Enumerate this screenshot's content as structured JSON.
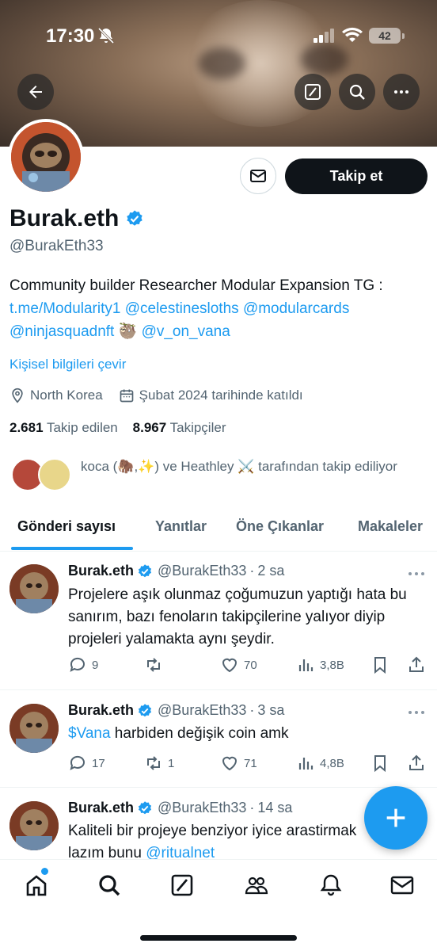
{
  "status": {
    "time": "17:30",
    "battery": "42"
  },
  "icons": {
    "back": "arrow-left-icon",
    "compose": "compose-icon",
    "search": "search-icon",
    "more": "more-icon"
  },
  "profile": {
    "name": "Burak.eth",
    "handle": "@BurakEth33",
    "follow_label": "Takip et",
    "bio_text": "Community builder Researcher Modular Expansion TG :",
    "bio_links": [
      "t.me/Modularity1",
      "@celestinesloths",
      "@modularcards",
      "@ninjasquadnft",
      "🦥",
      "@v_on_vana"
    ],
    "translate_label": "Kişisel bilgileri çevir",
    "location": "North Korea",
    "joined": "Şubat 2024 tarihinde katıldı",
    "following_count": "2.681",
    "following_label": "Takip edilen",
    "followers_count": "8.967",
    "followers_label": "Takipçiler",
    "known_followers": "koca (🦣,✨) ve Heathley ⚔️ tarafından takip ediliyor"
  },
  "tabs": [
    {
      "label": "Gönderi sayısı"
    },
    {
      "label": "Yanıtlar"
    },
    {
      "label": "Öne Çıkanlar"
    },
    {
      "label": "Makaleler"
    }
  ],
  "tweets": [
    {
      "name": "Burak.eth",
      "handle": "@BurakEth33",
      "time": "2 sa",
      "text": "Projelere aşık olunmaz çoğumuzun yaptığı hata bu sanırım, bazı fenoların takipçilerine yalıyor diyip projeleri yalamakta aynı şeydir.",
      "replies": "9",
      "retweets": "",
      "likes": "70",
      "views": "3,8B"
    },
    {
      "name": "Burak.eth",
      "handle": "@BurakEth33",
      "time": "3 sa",
      "cashtag": "$Vana",
      "text": " harbiden değişik coin amk",
      "replies": "17",
      "retweets": "1",
      "likes": "71",
      "views": "4,8B"
    },
    {
      "name": "Burak.eth",
      "handle": "@BurakEth33",
      "time": "14 sa",
      "text": "Kaliteli bir projeye benziyor iyice arastirmak",
      "text2": "lazım bunu ",
      "mention": "@ritualnet"
    }
  ],
  "colors": {
    "accent": "#1d9bf0",
    "text": "#0f1419",
    "muted": "#536471"
  }
}
